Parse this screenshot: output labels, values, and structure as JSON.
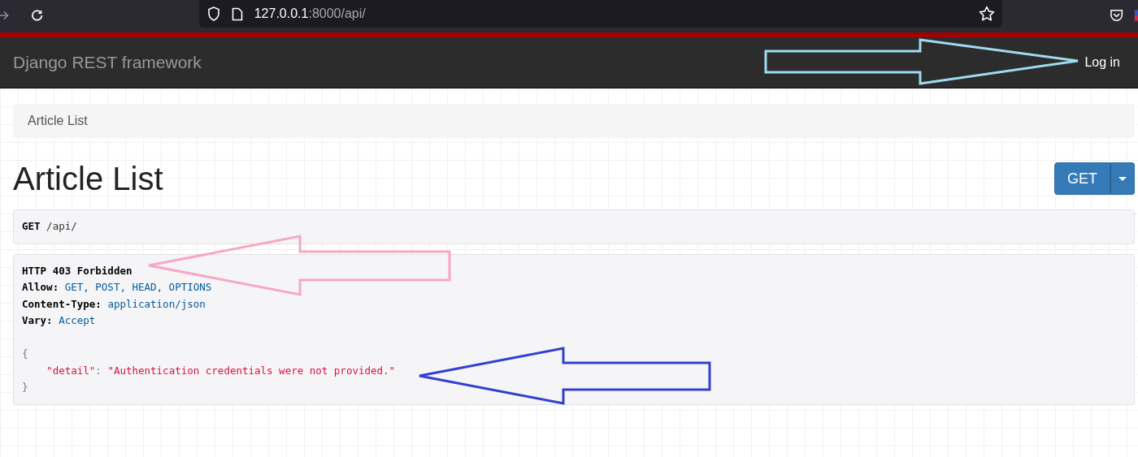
{
  "browser": {
    "url_host": "127.0.0.1",
    "url_rest": ":8000/api/"
  },
  "navbar": {
    "brand": "Django REST framework",
    "login": "Log in"
  },
  "breadcrumb": [
    "Article List"
  ],
  "title": "Article List",
  "method_button": "GET",
  "request": {
    "method": "GET",
    "path": "/api/"
  },
  "response": {
    "status": "HTTP 403 Forbidden",
    "headers": [
      {
        "name": "Allow:",
        "value": "GET, POST, HEAD, OPTIONS"
      },
      {
        "name": "Content-Type:",
        "value": "application/json"
      },
      {
        "name": "Vary:",
        "value": "Accept"
      }
    ],
    "open_brace": "{",
    "key": "\"detail\"",
    "colon": ":",
    "value": "\"Authentication credentials were not provided.\"",
    "close_brace": "}"
  }
}
